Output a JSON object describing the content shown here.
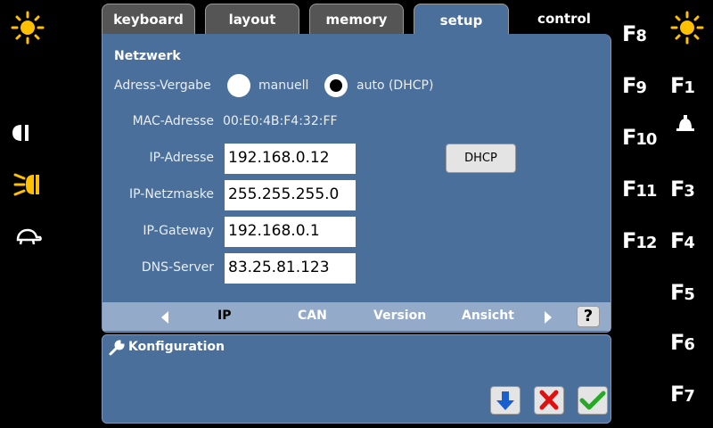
{
  "tabs": [
    "keyboard",
    "layout",
    "memory",
    "setup",
    "control"
  ],
  "network": {
    "section_title": "Netzwerk",
    "assign_label": "Adress-Vergabe",
    "option_manual": "manuell",
    "option_auto": "auto (DHCP)",
    "mac_label": "MAC-Adresse",
    "mac_value": "00:E0:4B:F4:32:FF",
    "ip_label": "IP-Adresse",
    "ip_value": "192.168.0.12",
    "mask_label": "IP-Netzmaske",
    "mask_value": "255.255.255.0",
    "gateway_label": "IP-Gateway",
    "gateway_value": "192.168.0.1",
    "dns_label": "DNS-Server",
    "dns_value": "83.25.81.123",
    "dhcp_button": "DHCP"
  },
  "subnav": [
    "IP",
    "CAN",
    "Version",
    "Ansicht"
  ],
  "help_label": "?",
  "config": {
    "title": "Konfiguration"
  },
  "fkeys_middle": [
    "8",
    "9",
    "10",
    "11",
    "12"
  ],
  "fkeys_right": [
    "1",
    "3",
    "4",
    "5",
    "6",
    "7"
  ],
  "colors": {
    "panel": "#4a6f9b",
    "sun": "#ffc000",
    "blue_arrow": "#1a5fcf",
    "red_x": "#e01010",
    "green_check": "#27a927"
  }
}
